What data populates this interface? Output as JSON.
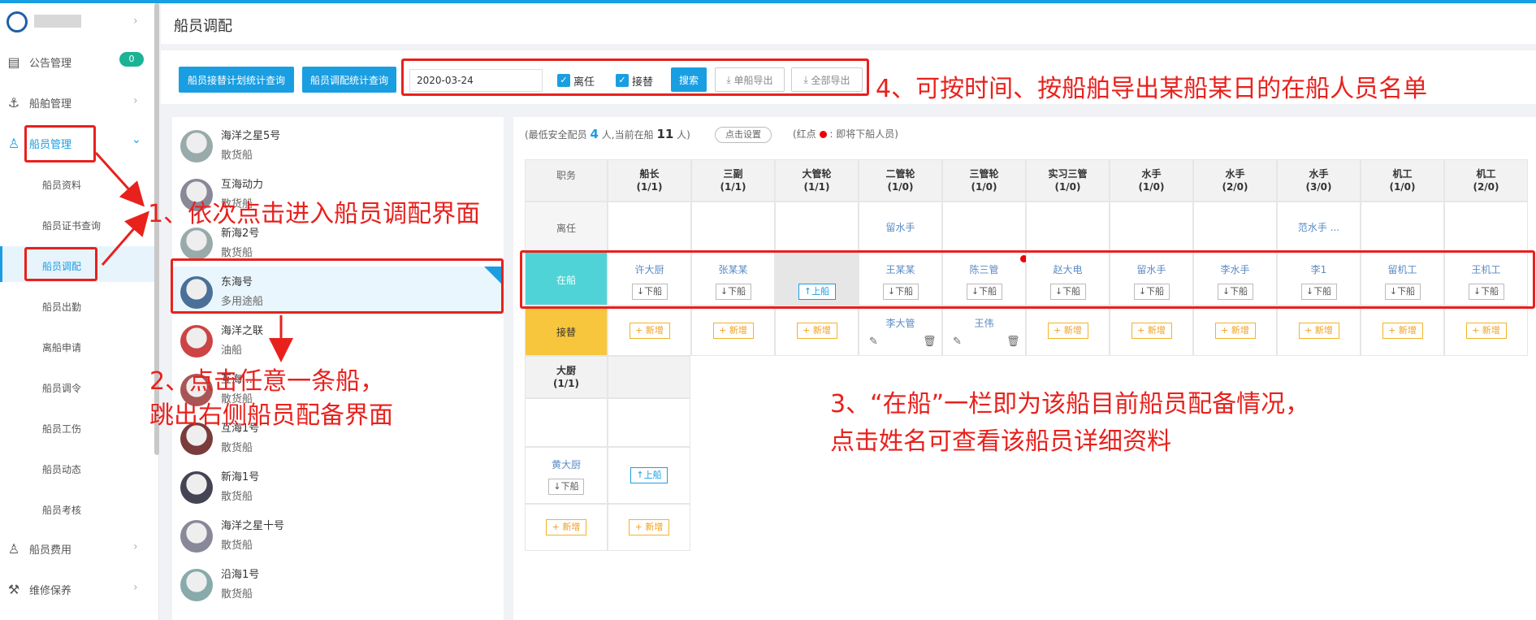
{
  "page_title": "船员调配",
  "sidebar": {
    "notice": {
      "label": "公告管理",
      "badge": "0"
    },
    "ship_mgmt": {
      "label": "船舶管理"
    },
    "crew_mgmt": {
      "label": "船员管理"
    },
    "sub_items": [
      "船员资料",
      "船员证书查询",
      "船员调配",
      "船员出勤",
      "离船申请",
      "船员调令",
      "船员工伤",
      "船员动态",
      "船员考核"
    ],
    "fees": {
      "label": "船员费用"
    },
    "maintenance": {
      "label": "维修保养"
    }
  },
  "toolbar": {
    "btn_plan_stats": "船员接替计划统计查询",
    "btn_alloc_stats": "船员调配统计查询",
    "date_value": "2020-03-24",
    "chk_leave_label": "离任",
    "chk_replace_label": "接替",
    "btn_search": "搜索",
    "btn_single_export": "单船导出",
    "btn_all_export": "全部导出"
  },
  "ships": [
    {
      "name": "海洋之星5号",
      "type": "散货船"
    },
    {
      "name": "互海动力",
      "type": "散货船"
    },
    {
      "name": "新海2号",
      "type": "散货船"
    },
    {
      "name": "东海号",
      "type": "多用途船"
    },
    {
      "name": "海洋之联",
      "type": "油船"
    },
    {
      "name": "互海…",
      "type": "散货船"
    },
    {
      "name": "互海1号",
      "type": "散货船"
    },
    {
      "name": "新海1号",
      "type": "散货船"
    },
    {
      "name": "海洋之星十号",
      "type": "散货船"
    },
    {
      "name": "沿海1号",
      "type": "散货船"
    }
  ],
  "crew_info": {
    "prefix": "(最低安全配员",
    "min_count": "4",
    "mid": "人,当前在船",
    "current_count": "11",
    "suffix": "人)",
    "set_button": "点击设置",
    "legend_prefix": "(红点",
    "legend_suffix": ":  即将下船人员)"
  },
  "table": {
    "row_labels": {
      "position": "职务",
      "leave": "离任",
      "onboard": "在船",
      "replace": "接替"
    },
    "positions": [
      {
        "name": "船长",
        "count": "(1/1)"
      },
      {
        "name": "三副",
        "count": "(1/1)"
      },
      {
        "name": "大管轮",
        "count": "(1/1)"
      },
      {
        "name": "二管轮",
        "count": "(1/0)"
      },
      {
        "name": "三管轮",
        "count": "(1/0)"
      },
      {
        "name": "实习三管",
        "count": "(1/0)"
      },
      {
        "name": "水手",
        "count": "(1/0)"
      },
      {
        "name": "水手",
        "count": "(2/0)"
      },
      {
        "name": "水手",
        "count": "(3/0)"
      },
      {
        "name": "机工",
        "count": "(1/0)"
      },
      {
        "name": "机工",
        "count": "(2/0)"
      }
    ],
    "leave": [
      "",
      "",
      "",
      "留水手",
      "",
      "",
      "",
      "",
      "范水手 ...",
      "",
      ""
    ],
    "onboard": [
      "许大厨",
      "张某某",
      "",
      "王某某",
      "陈三管",
      "赵大电",
      "留水手",
      "李水手",
      "李1",
      "留机工",
      "王机工"
    ],
    "replace": [
      "",
      "",
      "",
      "李大管",
      "王伟",
      "",
      "",
      "",
      "",
      "",
      ""
    ],
    "btn_off": "↓下船",
    "btn_on": "↑上船",
    "btn_add": "+ 新增",
    "cook": {
      "name": "大厨",
      "count": "(1/1)",
      "onboard": "黄大厨"
    }
  },
  "annotations": {
    "a1": "1、依次点击进入船员调配界面",
    "a2_line1": "2、点击任意一条船，",
    "a2_line2": "跳出右侧船员配备界面",
    "a3_line1": "3、“在船”一栏即为该船目前船员配备情况，",
    "a3_line2": "点击姓名可查看该船员详细资料",
    "a4": "4、可按时间、按船舶导出某船某日的在船人员名单",
    "color": "#e8211d"
  }
}
